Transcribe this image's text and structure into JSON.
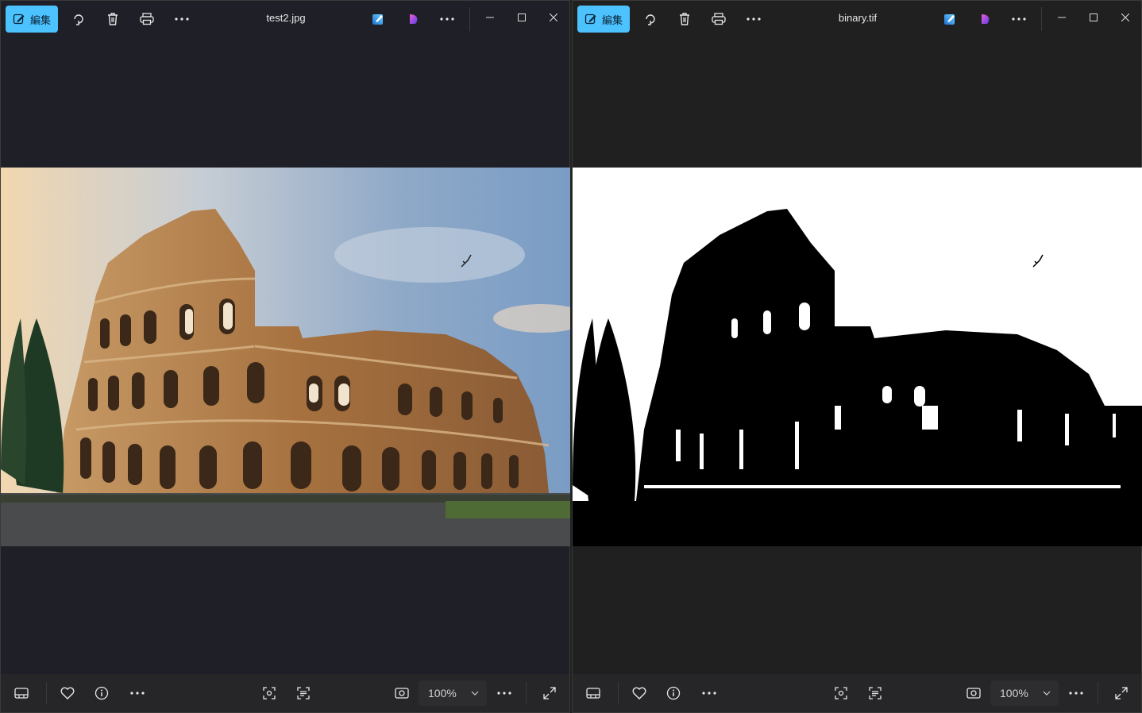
{
  "left_window": {
    "title": "test2.jpg",
    "edit_label": "編集",
    "zoom": "100%"
  },
  "right_window": {
    "title": "binary.tif",
    "edit_label": "編集",
    "zoom": "100%"
  },
  "icons": [
    "edit-icon",
    "rotate-icon",
    "delete-icon",
    "print-icon",
    "more-icon",
    "edit-image-icon",
    "designer-icon",
    "minimize-icon",
    "maximize-icon",
    "close-icon",
    "filmstrip-icon",
    "favorite-icon",
    "info-icon",
    "visual-search-icon",
    "text-scan-icon",
    "fit-icon",
    "chevron-down-icon",
    "fullscreen-icon"
  ],
  "colors": {
    "accent": "#4cc2ff",
    "bg": "#1f2027"
  }
}
